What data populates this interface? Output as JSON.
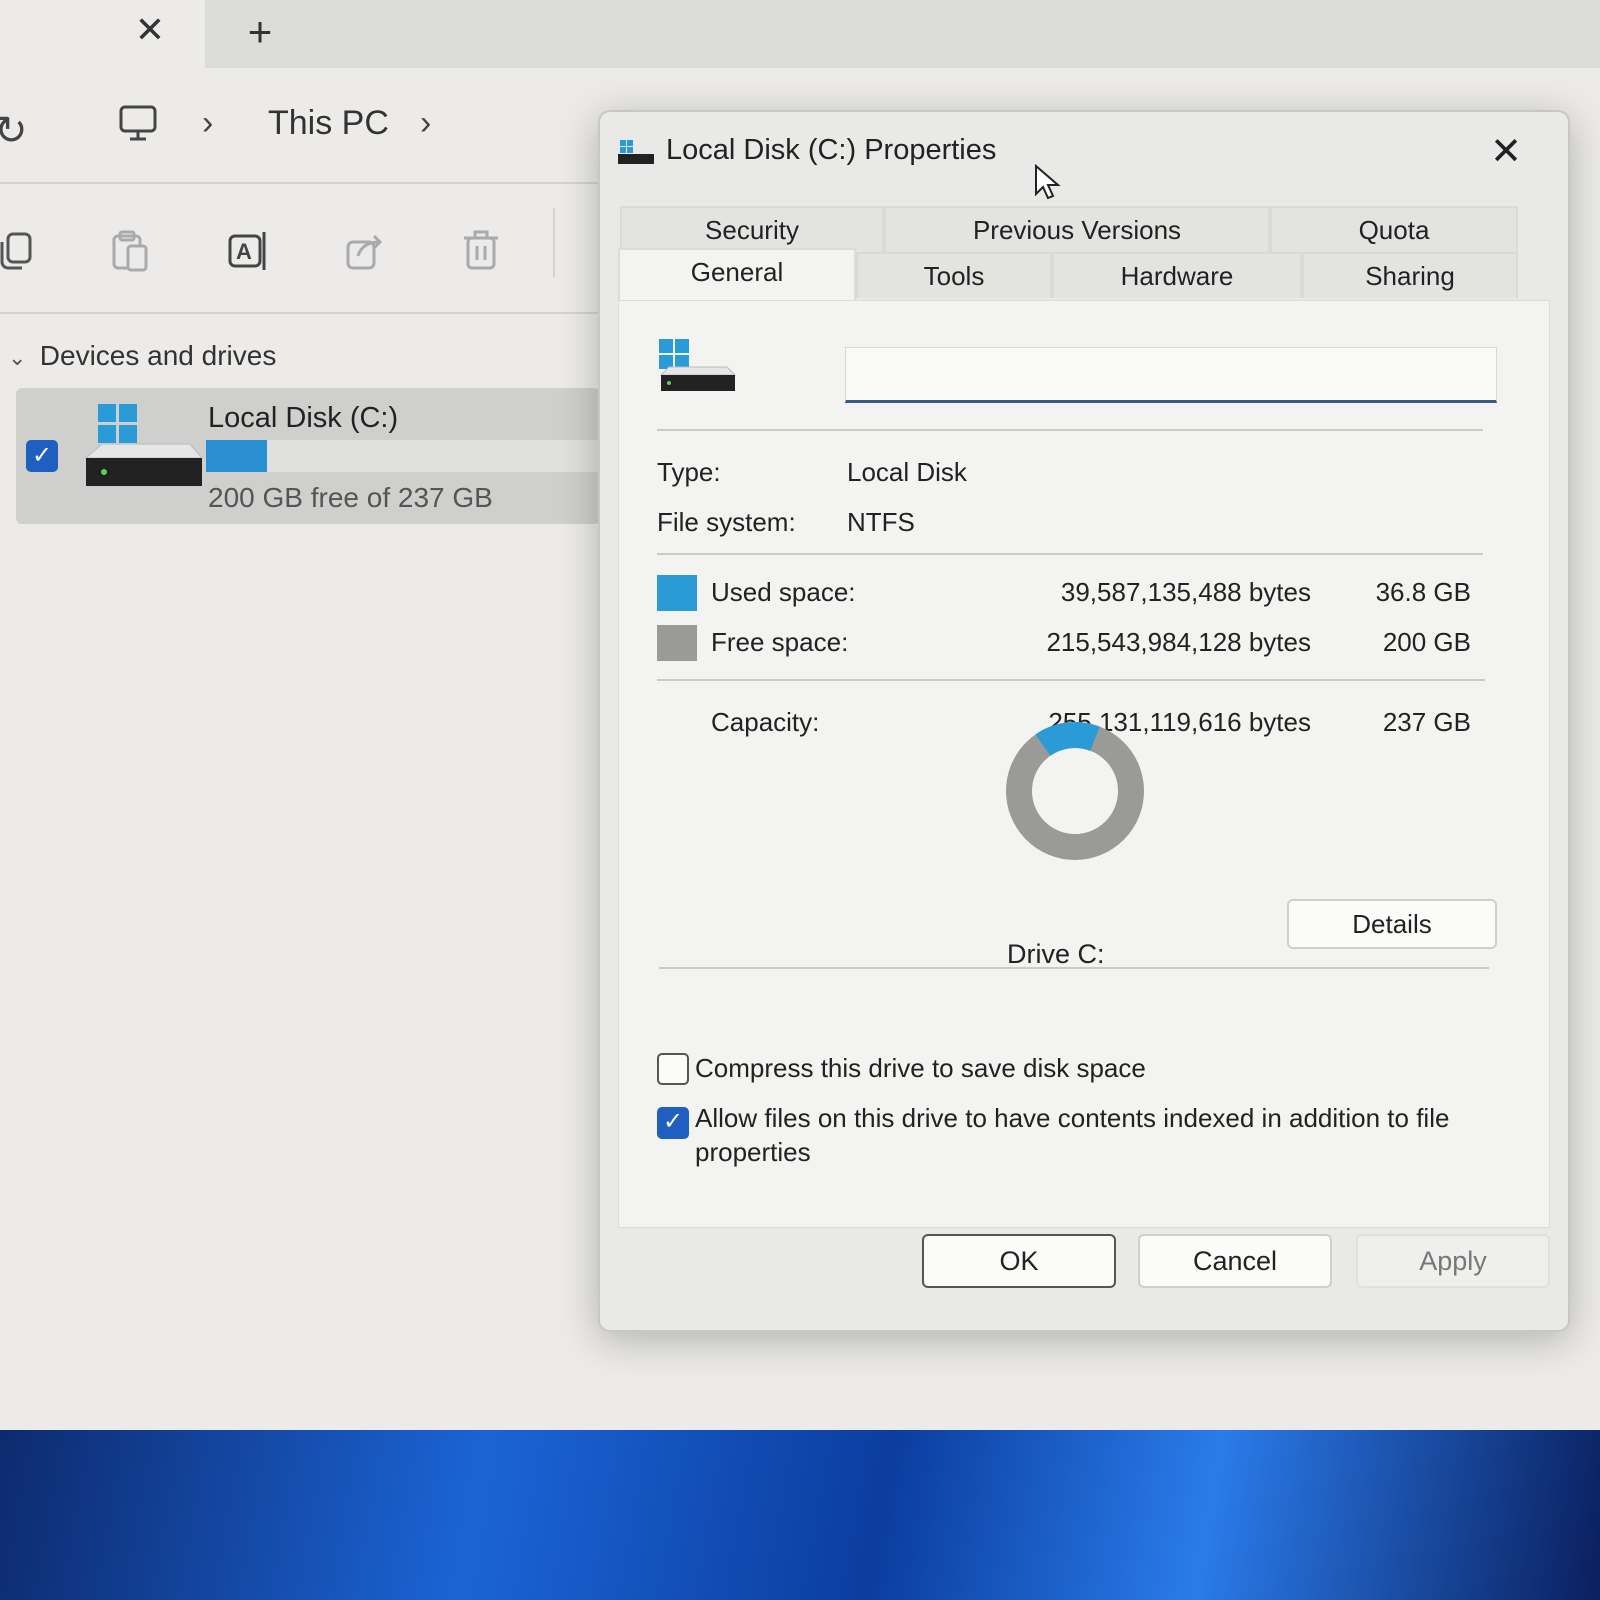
{
  "explorer": {
    "tab_close": "✕",
    "tab_new": "+",
    "breadcrumb": {
      "sep": "›",
      "location": "This PC"
    },
    "sidebar": {
      "section_title": "Devices and drives",
      "drive": {
        "name": "Local Disk (C:)",
        "free_text": "200 GB free of 237 GB",
        "used_fraction": 0.155,
        "checked": true,
        "accent": "#2a8fd0"
      }
    }
  },
  "dialog": {
    "title": "Local Disk (C:) Properties",
    "close": "✕",
    "tabs_row1": [
      {
        "label": "Security"
      },
      {
        "label": "Previous Versions"
      },
      {
        "label": "Quota"
      }
    ],
    "tabs_row2": [
      {
        "label": "General",
        "active": true
      },
      {
        "label": "Tools"
      },
      {
        "label": "Hardware"
      },
      {
        "label": "Sharing"
      }
    ],
    "general": {
      "name_value": "",
      "type_label": "Type:",
      "type_value": "Local Disk",
      "fs_label": "File system:",
      "fs_value": "NTFS",
      "used": {
        "label": "Used space:",
        "bytes": "39,587,135,488 bytes",
        "size": "36.8 GB",
        "color": "#2a9bd6"
      },
      "free": {
        "label": "Free space:",
        "bytes": "215,543,984,128 bytes",
        "size": "200 GB",
        "color": "#9a9a98"
      },
      "capacity": {
        "label": "Capacity:",
        "bytes": "255,131,119,616 bytes",
        "size": "237 GB"
      },
      "used_fraction": 0.155,
      "drive_label": "Drive C:",
      "details_button": "Details",
      "compress": {
        "label": "Compress this drive to save disk space",
        "checked": false
      },
      "index": {
        "label": "Allow files on this drive to have contents indexed in addition to file properties",
        "checked": true
      }
    },
    "buttons": {
      "ok": "OK",
      "cancel": "Cancel",
      "apply": "Apply"
    }
  }
}
